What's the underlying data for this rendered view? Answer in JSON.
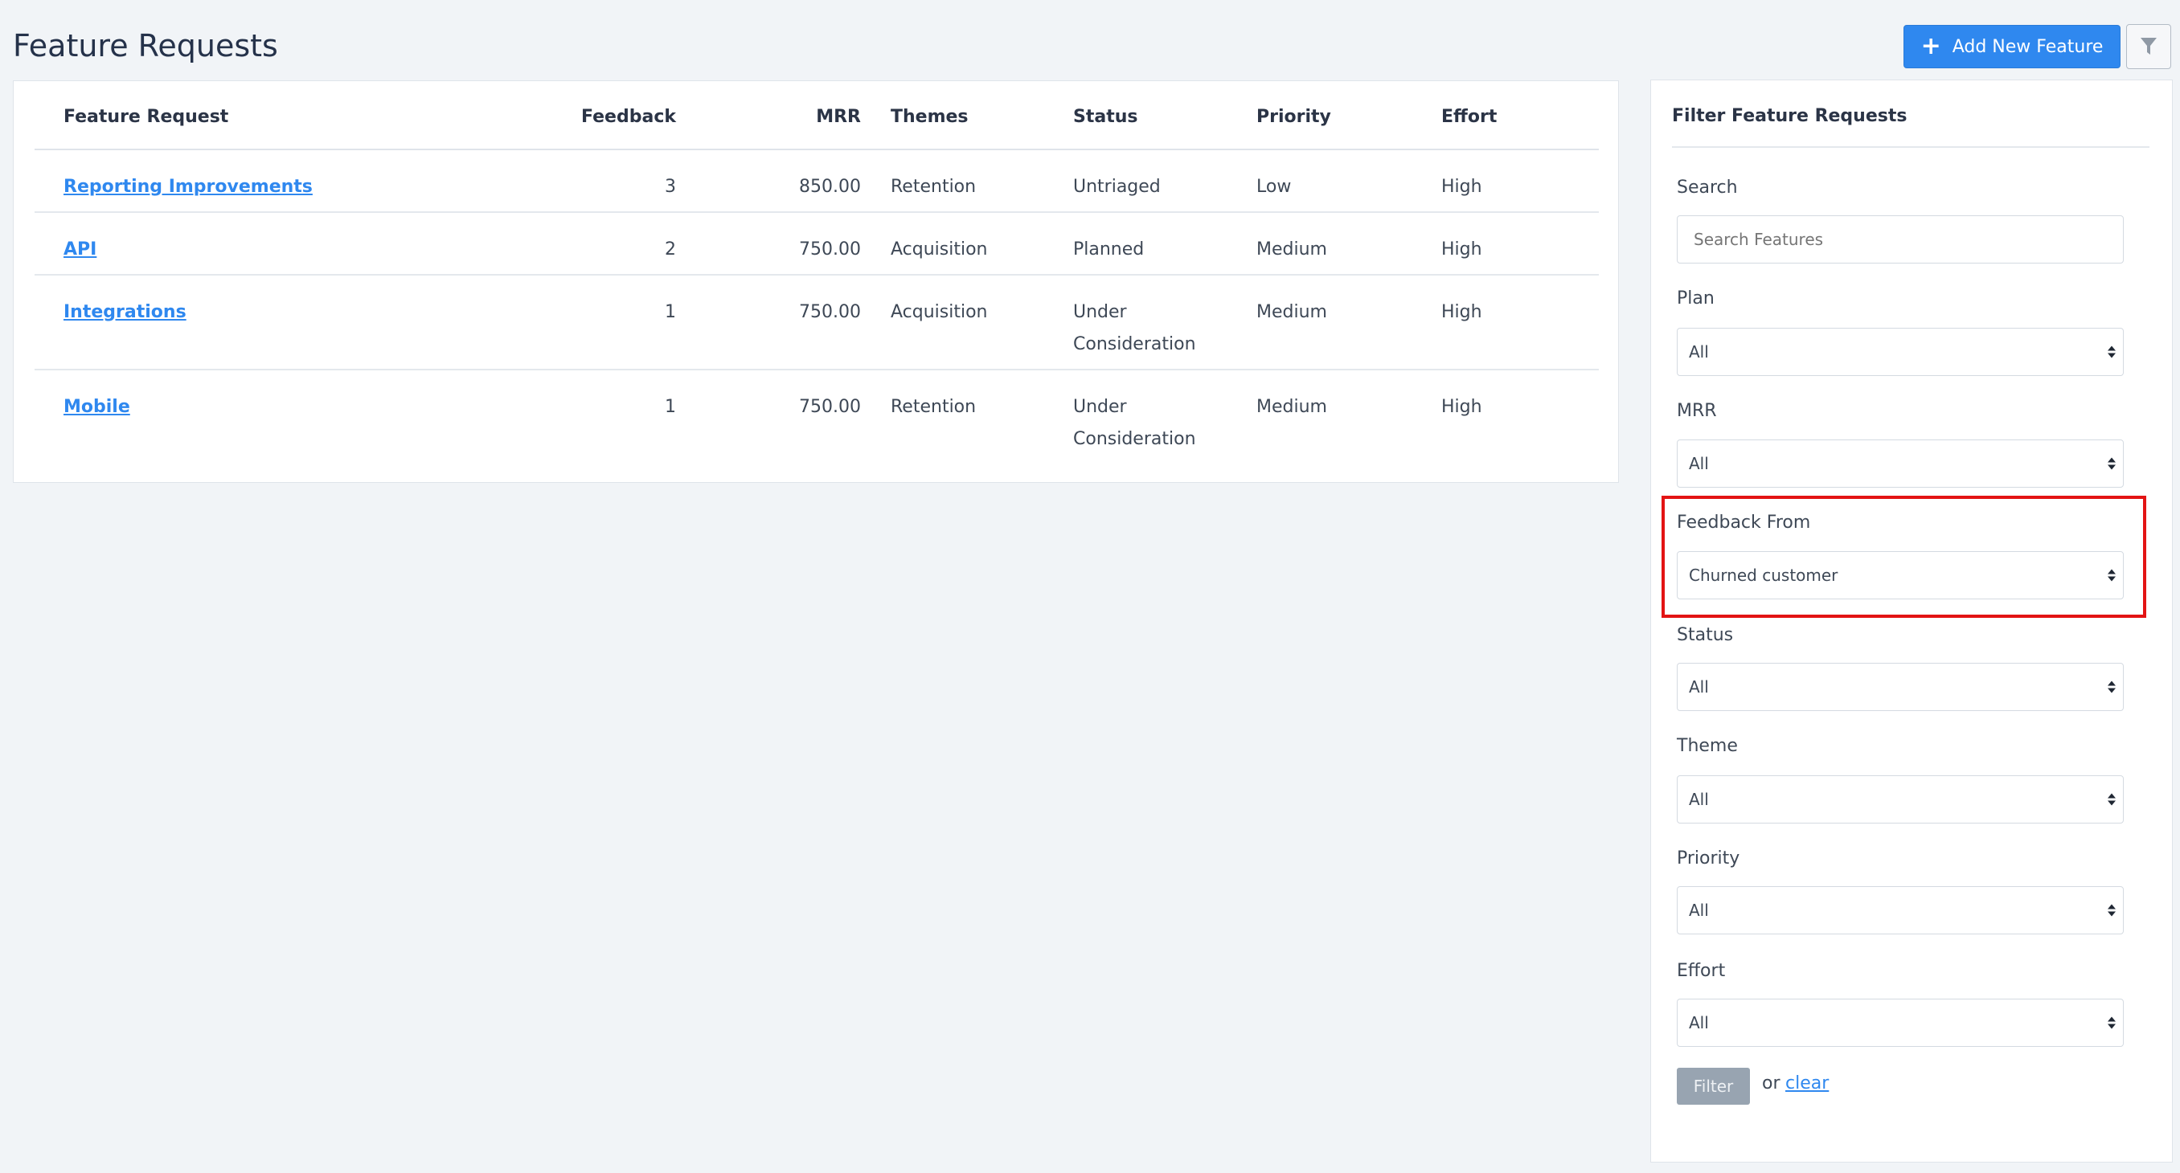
{
  "page": {
    "title": "Feature Requests",
    "add_button_label": "Add New Feature"
  },
  "table": {
    "headers": {
      "feature_request": "Feature Request",
      "feedback": "Feedback",
      "mrr": "MRR",
      "themes": "Themes",
      "status": "Status",
      "priority": "Priority",
      "effort": "Effort"
    },
    "rows": [
      {
        "name": "Reporting Improvements",
        "feedback": "3",
        "mrr": "850.00",
        "themes": "Retention",
        "status_line1": "Untriaged",
        "status_line2": "",
        "priority": "Low",
        "effort": "High"
      },
      {
        "name": "API",
        "feedback": "2",
        "mrr": "750.00",
        "themes": "Acquisition",
        "status_line1": "Planned",
        "status_line2": "",
        "priority": "Medium",
        "effort": "High"
      },
      {
        "name": "Integrations",
        "feedback": "1",
        "mrr": "750.00",
        "themes": "Acquisition",
        "status_line1": "Under",
        "status_line2": "Consideration",
        "priority": "Medium",
        "effort": "High"
      },
      {
        "name": "Mobile",
        "feedback": "1",
        "mrr": "750.00",
        "themes": "Retention",
        "status_line1": "Under",
        "status_line2": "Consideration",
        "priority": "Medium",
        "effort": "High"
      }
    ]
  },
  "filters": {
    "title": "Filter Feature Requests",
    "search": {
      "label": "Search",
      "placeholder": "Search Features",
      "value": ""
    },
    "plan": {
      "label": "Plan",
      "value": "All"
    },
    "mrr": {
      "label": "MRR",
      "value": "All"
    },
    "feedback_from": {
      "label": "Feedback From",
      "value": "Churned customer"
    },
    "status": {
      "label": "Status",
      "value": "All"
    },
    "theme": {
      "label": "Theme",
      "value": "All"
    },
    "priority": {
      "label": "Priority",
      "value": "All"
    },
    "effort": {
      "label": "Effort",
      "value": "All"
    },
    "submit_label": "Filter",
    "or_text": "or",
    "clear_label": "clear"
  },
  "colors": {
    "accent": "#2f88ef",
    "highlight": "#e31414",
    "background": "#f1f4f7"
  },
  "icons": {
    "add": "plus-icon",
    "filter_toggle": "funnel-icon",
    "select_arrows": "updown-arrows-icon"
  }
}
